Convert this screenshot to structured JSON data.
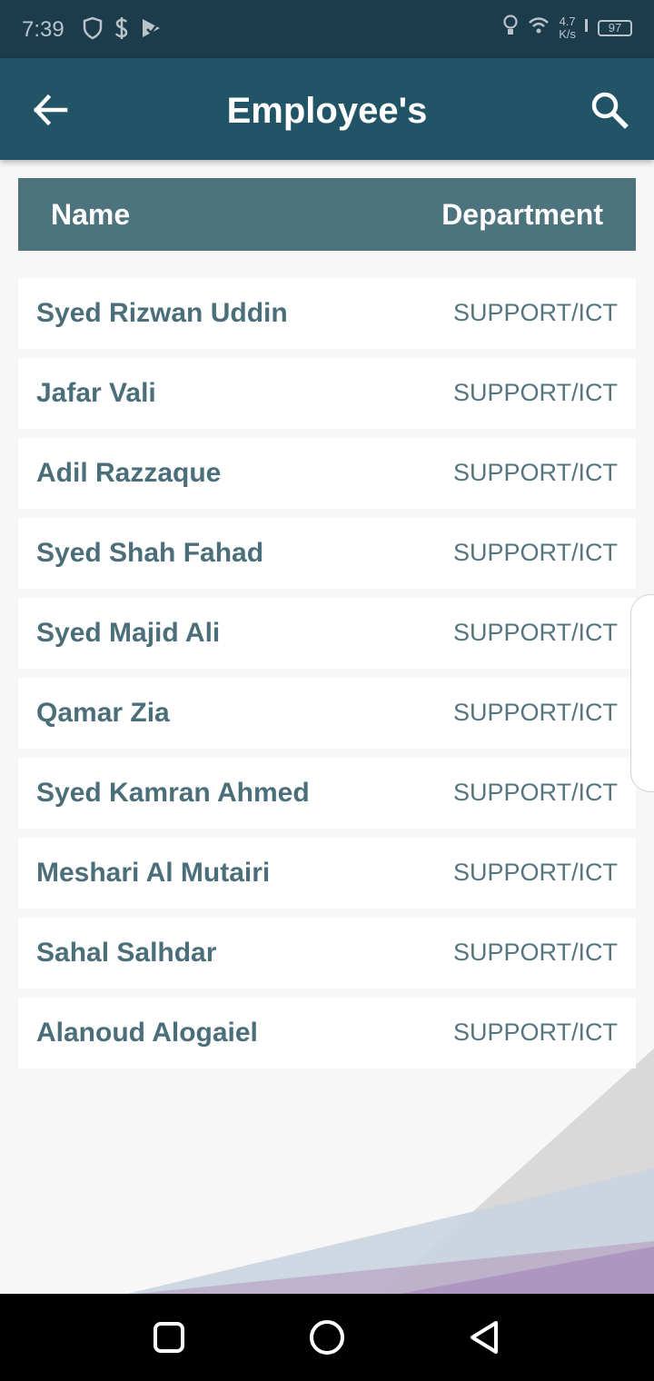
{
  "status_bar": {
    "time": "7:39",
    "net_speed_value": "4.7",
    "net_speed_unit": "K/s",
    "battery": "97",
    "icons": [
      "shield-icon",
      "dollar-icon",
      "play-store-icon",
      "bulb-icon",
      "wifi-icon",
      "signal-icon",
      "battery-icon"
    ]
  },
  "app_bar": {
    "title": "Employee's",
    "back_icon": "arrow-left-icon",
    "search_icon": "search-icon"
  },
  "table": {
    "columns": [
      "Name",
      "Department"
    ],
    "rows": [
      {
        "name": "Syed Rizwan Uddin",
        "department": "SUPPORT/ICT"
      },
      {
        "name": "Jafar Vali",
        "department": "SUPPORT/ICT"
      },
      {
        "name": "Adil Razzaque",
        "department": "SUPPORT/ICT"
      },
      {
        "name": "Syed Shah Fahad",
        "department": "SUPPORT/ICT"
      },
      {
        "name": "Syed Majid Ali",
        "department": "SUPPORT/ICT"
      },
      {
        "name": "Qamar Zia",
        "department": "SUPPORT/ICT"
      },
      {
        "name": "Syed Kamran Ahmed",
        "department": "SUPPORT/ICT"
      },
      {
        "name": "Meshari Al Mutairi",
        "department": "SUPPORT/ICT"
      },
      {
        "name": "Sahal Salhdar",
        "department": "SUPPORT/ICT"
      },
      {
        "name": "Alanoud Alogaiel",
        "department": "SUPPORT/ICT"
      }
    ]
  },
  "nav_bar": {
    "icons": [
      "recents-square-icon",
      "home-circle-icon",
      "back-triangle-icon"
    ]
  },
  "colors": {
    "status_bar": "#1c3b4b",
    "app_bar": "#215466",
    "header": "#4d737f",
    "row_text": "#4a6e7a",
    "background": "#f7f7f7"
  }
}
